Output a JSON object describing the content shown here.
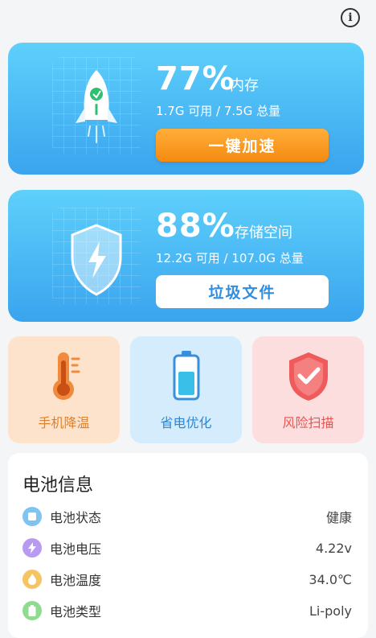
{
  "header": {
    "info_icon": "info-icon",
    "info_glyph": "i"
  },
  "memory": {
    "percent": "77%",
    "label": "内存",
    "detail": "1.7G 可用 / 7.5G 总量",
    "button": "一键加速",
    "icon": "rocket-icon"
  },
  "storage": {
    "percent": "88%",
    "label": "存储空间",
    "detail": "12.2G 可用 / 107.0G 总量",
    "button": "垃圾文件",
    "icon": "shield-bolt-icon"
  },
  "tools": [
    {
      "label": "手机降温",
      "icon": "thermometer-icon"
    },
    {
      "label": "省电优化",
      "icon": "battery-icon"
    },
    {
      "label": "风险扫描",
      "icon": "shield-check-icon"
    }
  ],
  "battery": {
    "title": "电池信息",
    "rows": [
      {
        "label": "电池状态",
        "value": "健康",
        "color": "#7fc3f0",
        "icon": "status-icon"
      },
      {
        "label": "电池电压",
        "value": "4.22v",
        "color": "#b89af0",
        "icon": "bolt-icon"
      },
      {
        "label": "电池温度",
        "value": "34.0℃",
        "color": "#f5c563",
        "icon": "flame-icon"
      },
      {
        "label": "电池类型",
        "value": "Li-poly",
        "color": "#8fdc8f",
        "icon": "battery-type-icon"
      }
    ]
  },
  "colors": {
    "accent": "#3aa4ee",
    "boost": "#f58a10"
  }
}
